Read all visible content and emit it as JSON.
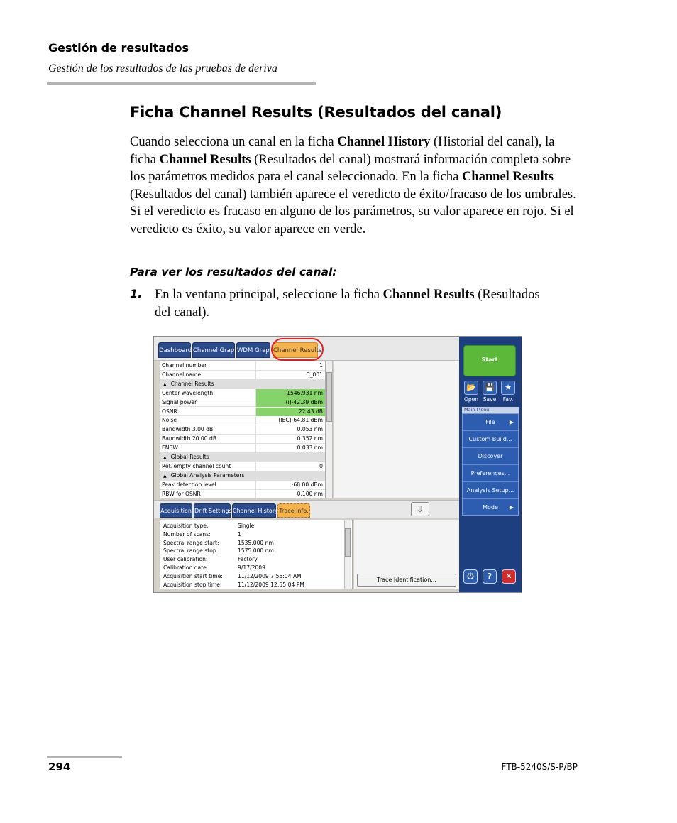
{
  "header": {
    "chapter": "Gestión de resultados",
    "section": "Gestión de los resultados de las pruebas de deriva"
  },
  "heading": "Ficha Channel Results (Resultados del canal)",
  "paragraph": {
    "t1": "Cuando selecciona un canal en la ficha ",
    "b1": "Channel History",
    "t2": " (Historial del canal), la ficha ",
    "b2": "Channel Results",
    "t3": " (Resultados del canal) mostrará información completa sobre los parámetros medidos para el canal seleccionado. En la ficha ",
    "b3": "Channel Results",
    "t4": " (Resultados del canal) también aparece el veredicto de éxito/fracaso de los umbrales. Si el veredicto es fracaso en alguno de los parámetros, su valor aparece en rojo. Si el veredicto es éxito, su valor aparece en verde."
  },
  "procedure_title": "Para ver los resultados del canal:",
  "step1": {
    "num": "1.",
    "t1": "En la ventana principal, seleccione la ficha ",
    "b1": "Channel Results",
    "t2": " (Resultados del canal)."
  },
  "screenshot": {
    "top_tabs": [
      "Dashboard",
      "Channel Graph",
      "WDM Graph",
      "Channel Results"
    ],
    "active_top_tab": "Channel Results",
    "results_rows": [
      {
        "key": "Channel number",
        "value": "1"
      },
      {
        "key": "Channel name",
        "value": "C_001"
      },
      {
        "key": "Channel Results",
        "group": true,
        "collapse_icon": "▲"
      },
      {
        "key": "Center wavelength",
        "value": "1546.931 nm",
        "status": "pass"
      },
      {
        "key": "Signal power",
        "value": "(i)-42.39 dBm",
        "status": "pass"
      },
      {
        "key": "OSNR",
        "value": "22.43 dB",
        "status": "pass"
      },
      {
        "key": "Noise",
        "value": "(IEC)-64.81 dBm"
      },
      {
        "key": "Bandwidth 3.00 dB",
        "value": "0.053 nm"
      },
      {
        "key": "Bandwidth 20.00 dB",
        "value": "0.352 nm"
      },
      {
        "key": "ENBW",
        "value": "0.033 nm"
      },
      {
        "key": "Global Results",
        "group": true,
        "collapse_icon": "▲"
      },
      {
        "key": "Ref. empty channel count",
        "value": "0"
      },
      {
        "key": "Global Analysis Parameters",
        "group": true,
        "collapse_icon": "▲"
      },
      {
        "key": "Peak detection level",
        "value": "-60.00 dBm"
      },
      {
        "key": "RBW for OSNR",
        "value": "0.100 nm"
      }
    ],
    "bottom_tabs": [
      "Acquisition",
      "Drift Settings",
      "Channel History",
      "Trace Info."
    ],
    "active_bottom_tab": "Trace Info.",
    "expand_icon": "⇩",
    "trace_info": [
      {
        "key": "Acquisition type:",
        "value": "Single"
      },
      {
        "key": "Number of scans:",
        "value": "1"
      },
      {
        "key": "Spectral range start:",
        "value": "1535.000 nm"
      },
      {
        "key": "Spectral range stop:",
        "value": "1575.000 nm"
      },
      {
        "key": "User calibration:",
        "value": "Factory"
      },
      {
        "key": "Calibration date:",
        "value": "9/17/2009"
      },
      {
        "key": "Acquisition start time:",
        "value": "11/12/2009 7:55:04 AM"
      },
      {
        "key": "Acquisition stop time:",
        "value": "11/12/2009 12:55:04 PM"
      }
    ],
    "trace_id_button": "Trace Identification...",
    "start_button": "Start",
    "file_buttons": [
      {
        "label": "Open",
        "icon": "folder-open-icon",
        "glyph": "📂"
      },
      {
        "label": "Save",
        "icon": "save-icon",
        "glyph": "💾"
      },
      {
        "label": "Fav.",
        "icon": "star-icon",
        "glyph": "★"
      }
    ],
    "main_menu_title": "Main Menu",
    "main_menu": [
      {
        "label": "File",
        "arrow": "▶"
      },
      {
        "label": "Custom Build..."
      },
      {
        "label": "Discover"
      },
      {
        "label": "Preferences..."
      },
      {
        "label": "Analysis Setup..."
      },
      {
        "label": "Mode",
        "arrow": "▶"
      }
    ],
    "bottom_icons": [
      {
        "name": "power-icon",
        "glyph": "⏻",
        "color": "#2d5db1"
      },
      {
        "name": "help-icon",
        "glyph": "?",
        "color": "#2d5db1"
      },
      {
        "name": "close-icon",
        "glyph": "✕",
        "color": "#d62b2b"
      }
    ],
    "colors": {
      "tab": "#2b4c8c",
      "active_tab": "#f5b24a",
      "pass": "#86d36a",
      "highlight_circle": "#e02020",
      "sidebar": "#1d3f80"
    }
  },
  "footer": {
    "page_number": "294",
    "product": "FTB-5240S/S-P/BP"
  }
}
